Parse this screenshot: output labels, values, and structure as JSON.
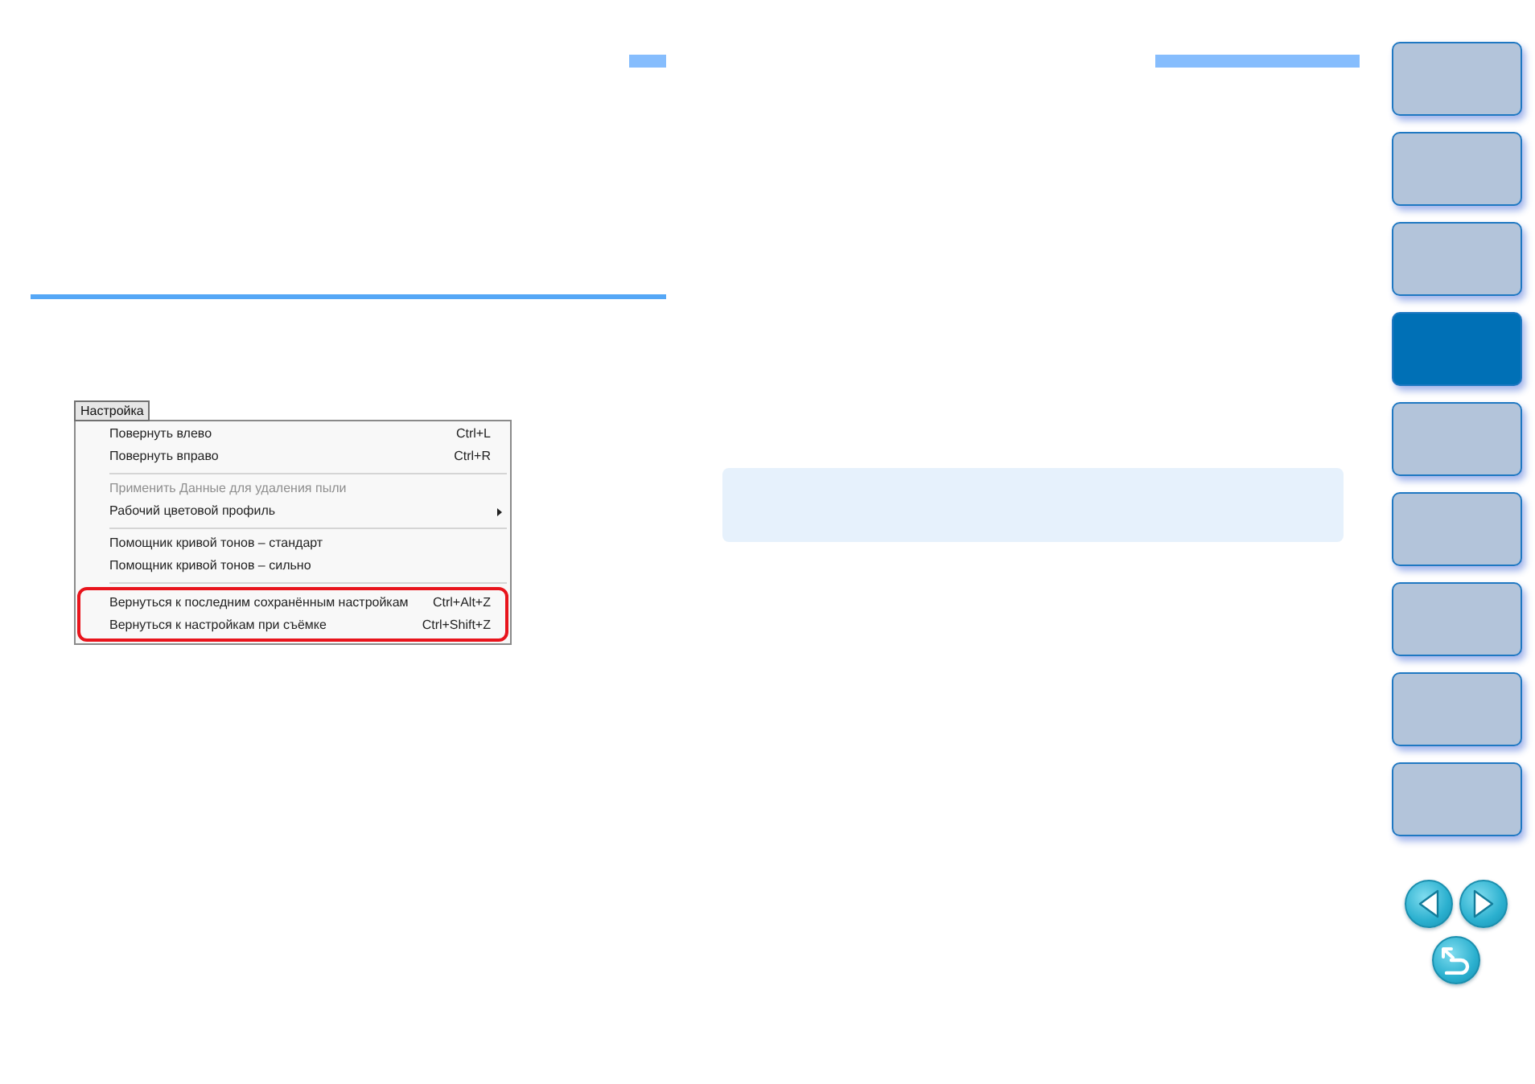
{
  "menu_screenshot": {
    "title": "Настройка",
    "items": [
      {
        "kind": "item",
        "label": "Повернуть влево",
        "shortcut": "Ctrl+L",
        "disabled": false,
        "submenu": false,
        "highlighted": false
      },
      {
        "kind": "item",
        "label": "Повернуть вправо",
        "shortcut": "Ctrl+R",
        "disabled": false,
        "submenu": false,
        "highlighted": false
      },
      {
        "kind": "separator"
      },
      {
        "kind": "item",
        "label": "Применить Данные для удаления пыли",
        "disabled": true,
        "submenu": false,
        "highlighted": false
      },
      {
        "kind": "item",
        "label": "Рабочий цветовой профиль",
        "disabled": false,
        "submenu": true,
        "highlighted": false
      },
      {
        "kind": "separator"
      },
      {
        "kind": "item",
        "label": "Помощник кривой тонов – стандарт",
        "disabled": false,
        "submenu": false,
        "highlighted": false
      },
      {
        "kind": "item",
        "label": "Помощник кривой тонов – сильно",
        "disabled": false,
        "submenu": false,
        "highlighted": false
      },
      {
        "kind": "separator"
      },
      {
        "kind": "item",
        "label": "Вернуться к последним сохранённым настройкам",
        "shortcut": "Ctrl+Alt+Z",
        "disabled": false,
        "submenu": false,
        "highlighted": true
      },
      {
        "kind": "item",
        "label": "Вернуться к настройкам при съёмке",
        "shortcut": "Ctrl+Shift+Z",
        "disabled": false,
        "submenu": false,
        "highlighted": true
      }
    ]
  },
  "sidebar": {
    "tabs": [
      {
        "selected": false
      },
      {
        "selected": false
      },
      {
        "selected": false
      },
      {
        "selected": true
      },
      {
        "selected": false
      },
      {
        "selected": false
      },
      {
        "selected": false
      },
      {
        "selected": false
      },
      {
        "selected": false
      }
    ]
  }
}
